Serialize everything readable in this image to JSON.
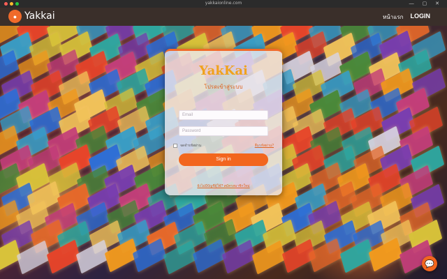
{
  "browser": {
    "url": "yakkaionline.com"
  },
  "navbar": {
    "brand": "Yakkai",
    "home_label": "หน้าแรก",
    "login_label": "LOGIN"
  },
  "login_card": {
    "logo": "YakKai",
    "subtitle": "โปรดเข้าสู่ระบบ",
    "email_placeholder": "Email",
    "password_placeholder": "Password",
    "remember_label": "จดจำรหัสผ่าน",
    "forgot_label": "ลืมรหัสผ่าน?",
    "signin_label": "Sign in",
    "register_label": "ยังไม่มีบัญชีผู้ใช้? สมัครสมาชิกใหม่"
  },
  "colors": {
    "accent": "#f2661e",
    "logo": "#f0a21e",
    "navbar": "#3a2f2a"
  },
  "icons": {
    "chat": "chat-bubble-icon",
    "logo": "yakkai-logo-icon"
  }
}
